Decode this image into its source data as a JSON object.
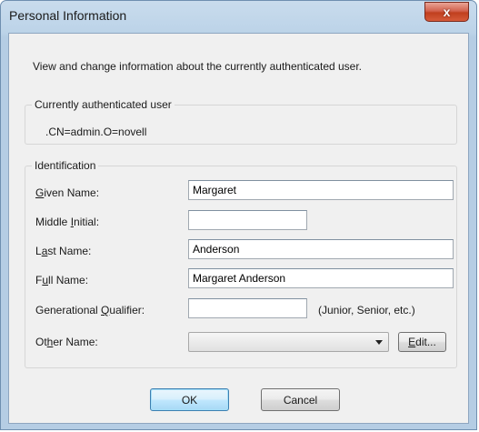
{
  "window": {
    "title": "Personal Information",
    "close_glyph": "x"
  },
  "intro_text": "View and change information about the currently authenticated user.",
  "auth_group": {
    "legend": "Currently authenticated user",
    "value": ".CN=admin.O=novell"
  },
  "identification": {
    "legend": "Identification",
    "given_name": {
      "label_pre": "",
      "label_u": "G",
      "label_post": "iven Name:",
      "value": "Margaret"
    },
    "middle_initial": {
      "label_pre": "Middle ",
      "label_u": "I",
      "label_post": "nitial:",
      "value": ""
    },
    "last_name": {
      "label_pre": "L",
      "label_u": "a",
      "label_post": "st Name:",
      "value": "Anderson"
    },
    "full_name": {
      "label_pre": "F",
      "label_u": "u",
      "label_post": "ll Name:",
      "value": "Margaret Anderson"
    },
    "generational_qualifier": {
      "label_pre": "Generational ",
      "label_u": "Q",
      "label_post": "ualifier:",
      "value": "",
      "hint": "(Junior, Senior, etc.)"
    },
    "other_name": {
      "label_pre": "Ot",
      "label_u": "h",
      "label_post": "er Name:",
      "selected": "",
      "edit_pre": "",
      "edit_u": "E",
      "edit_post": "dit..."
    }
  },
  "buttons": {
    "ok": "OK",
    "cancel": "Cancel"
  },
  "colors": {
    "title_bar": "#bcd3e8",
    "close_button": "#c0401f",
    "client_bg": "#f0f0f0",
    "default_button_border": "#3c7fb1"
  }
}
